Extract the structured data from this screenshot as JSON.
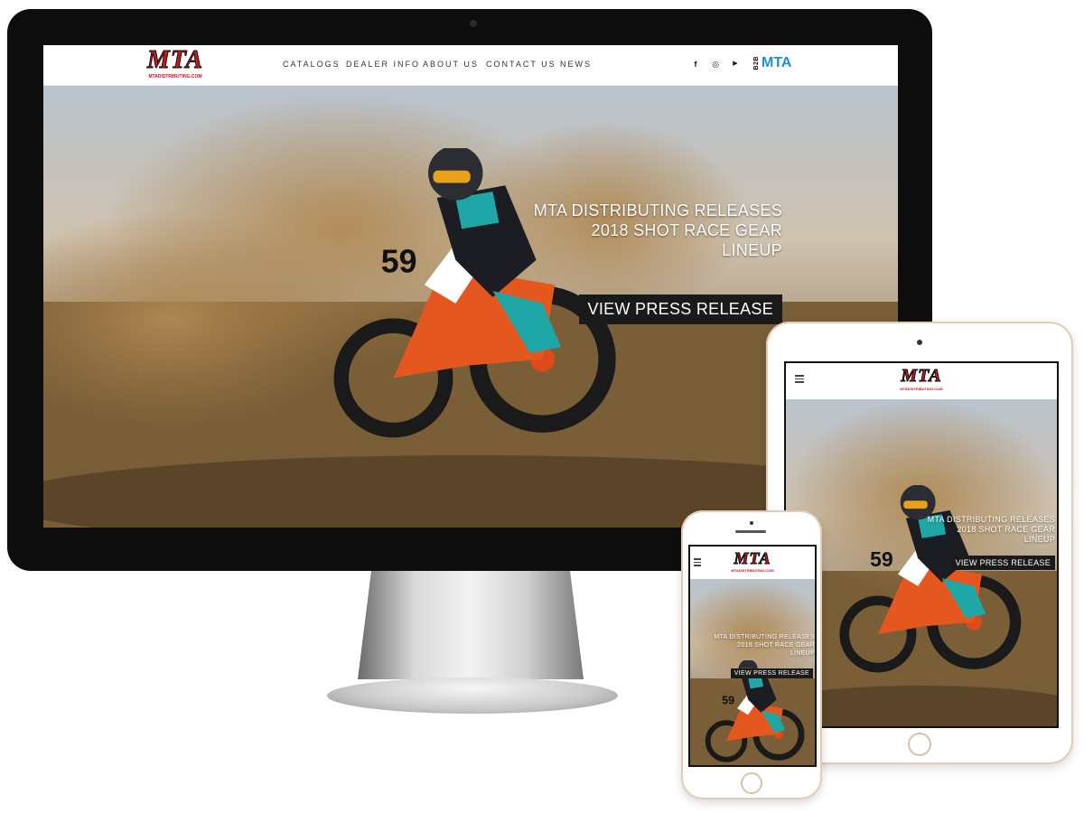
{
  "brand": {
    "logo_text": "MTA",
    "logo_subtext": "MTADISTRIBUTING.COM",
    "accent_red": "#c8161d",
    "b2b_accent": "#1e8fd6"
  },
  "nav": {
    "items": [
      {
        "label": "CATALOGS"
      },
      {
        "label": "DEALER INFO"
      },
      {
        "label": "ABOUT US"
      },
      {
        "label": "CONTACT US"
      },
      {
        "label": "NEWS"
      }
    ],
    "social": [
      {
        "icon": "facebook-icon",
        "glyph": "f"
      },
      {
        "icon": "instagram-icon",
        "glyph": "◎"
      },
      {
        "icon": "youtube-icon",
        "glyph": "▶"
      }
    ],
    "b2b": {
      "small": "B2B",
      "main": "MTA"
    }
  },
  "hero": {
    "headline_lines": [
      "MTA DISTRIBUTING RELEASES",
      "2018 SHOT RACE GEAR",
      "LINEUP"
    ],
    "button_label": "VIEW PRESS RELEASE",
    "rider_number": "59"
  }
}
